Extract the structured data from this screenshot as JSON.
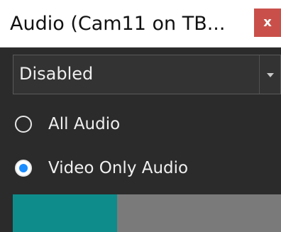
{
  "window": {
    "title": "Audio (Cam11 on TB..."
  },
  "close_button": {
    "glyph": "x",
    "color": "#c9504a"
  },
  "audio_source": {
    "selected": "Disabled"
  },
  "audio_mode": {
    "options": [
      {
        "label": "All Audio",
        "checked": false
      },
      {
        "label": "Video Only Audio",
        "checked": true
      }
    ]
  },
  "level_meter": {
    "level_fraction": 0.39,
    "fill_color": "#0e8c8c",
    "track_color": "#7a7a7a"
  }
}
